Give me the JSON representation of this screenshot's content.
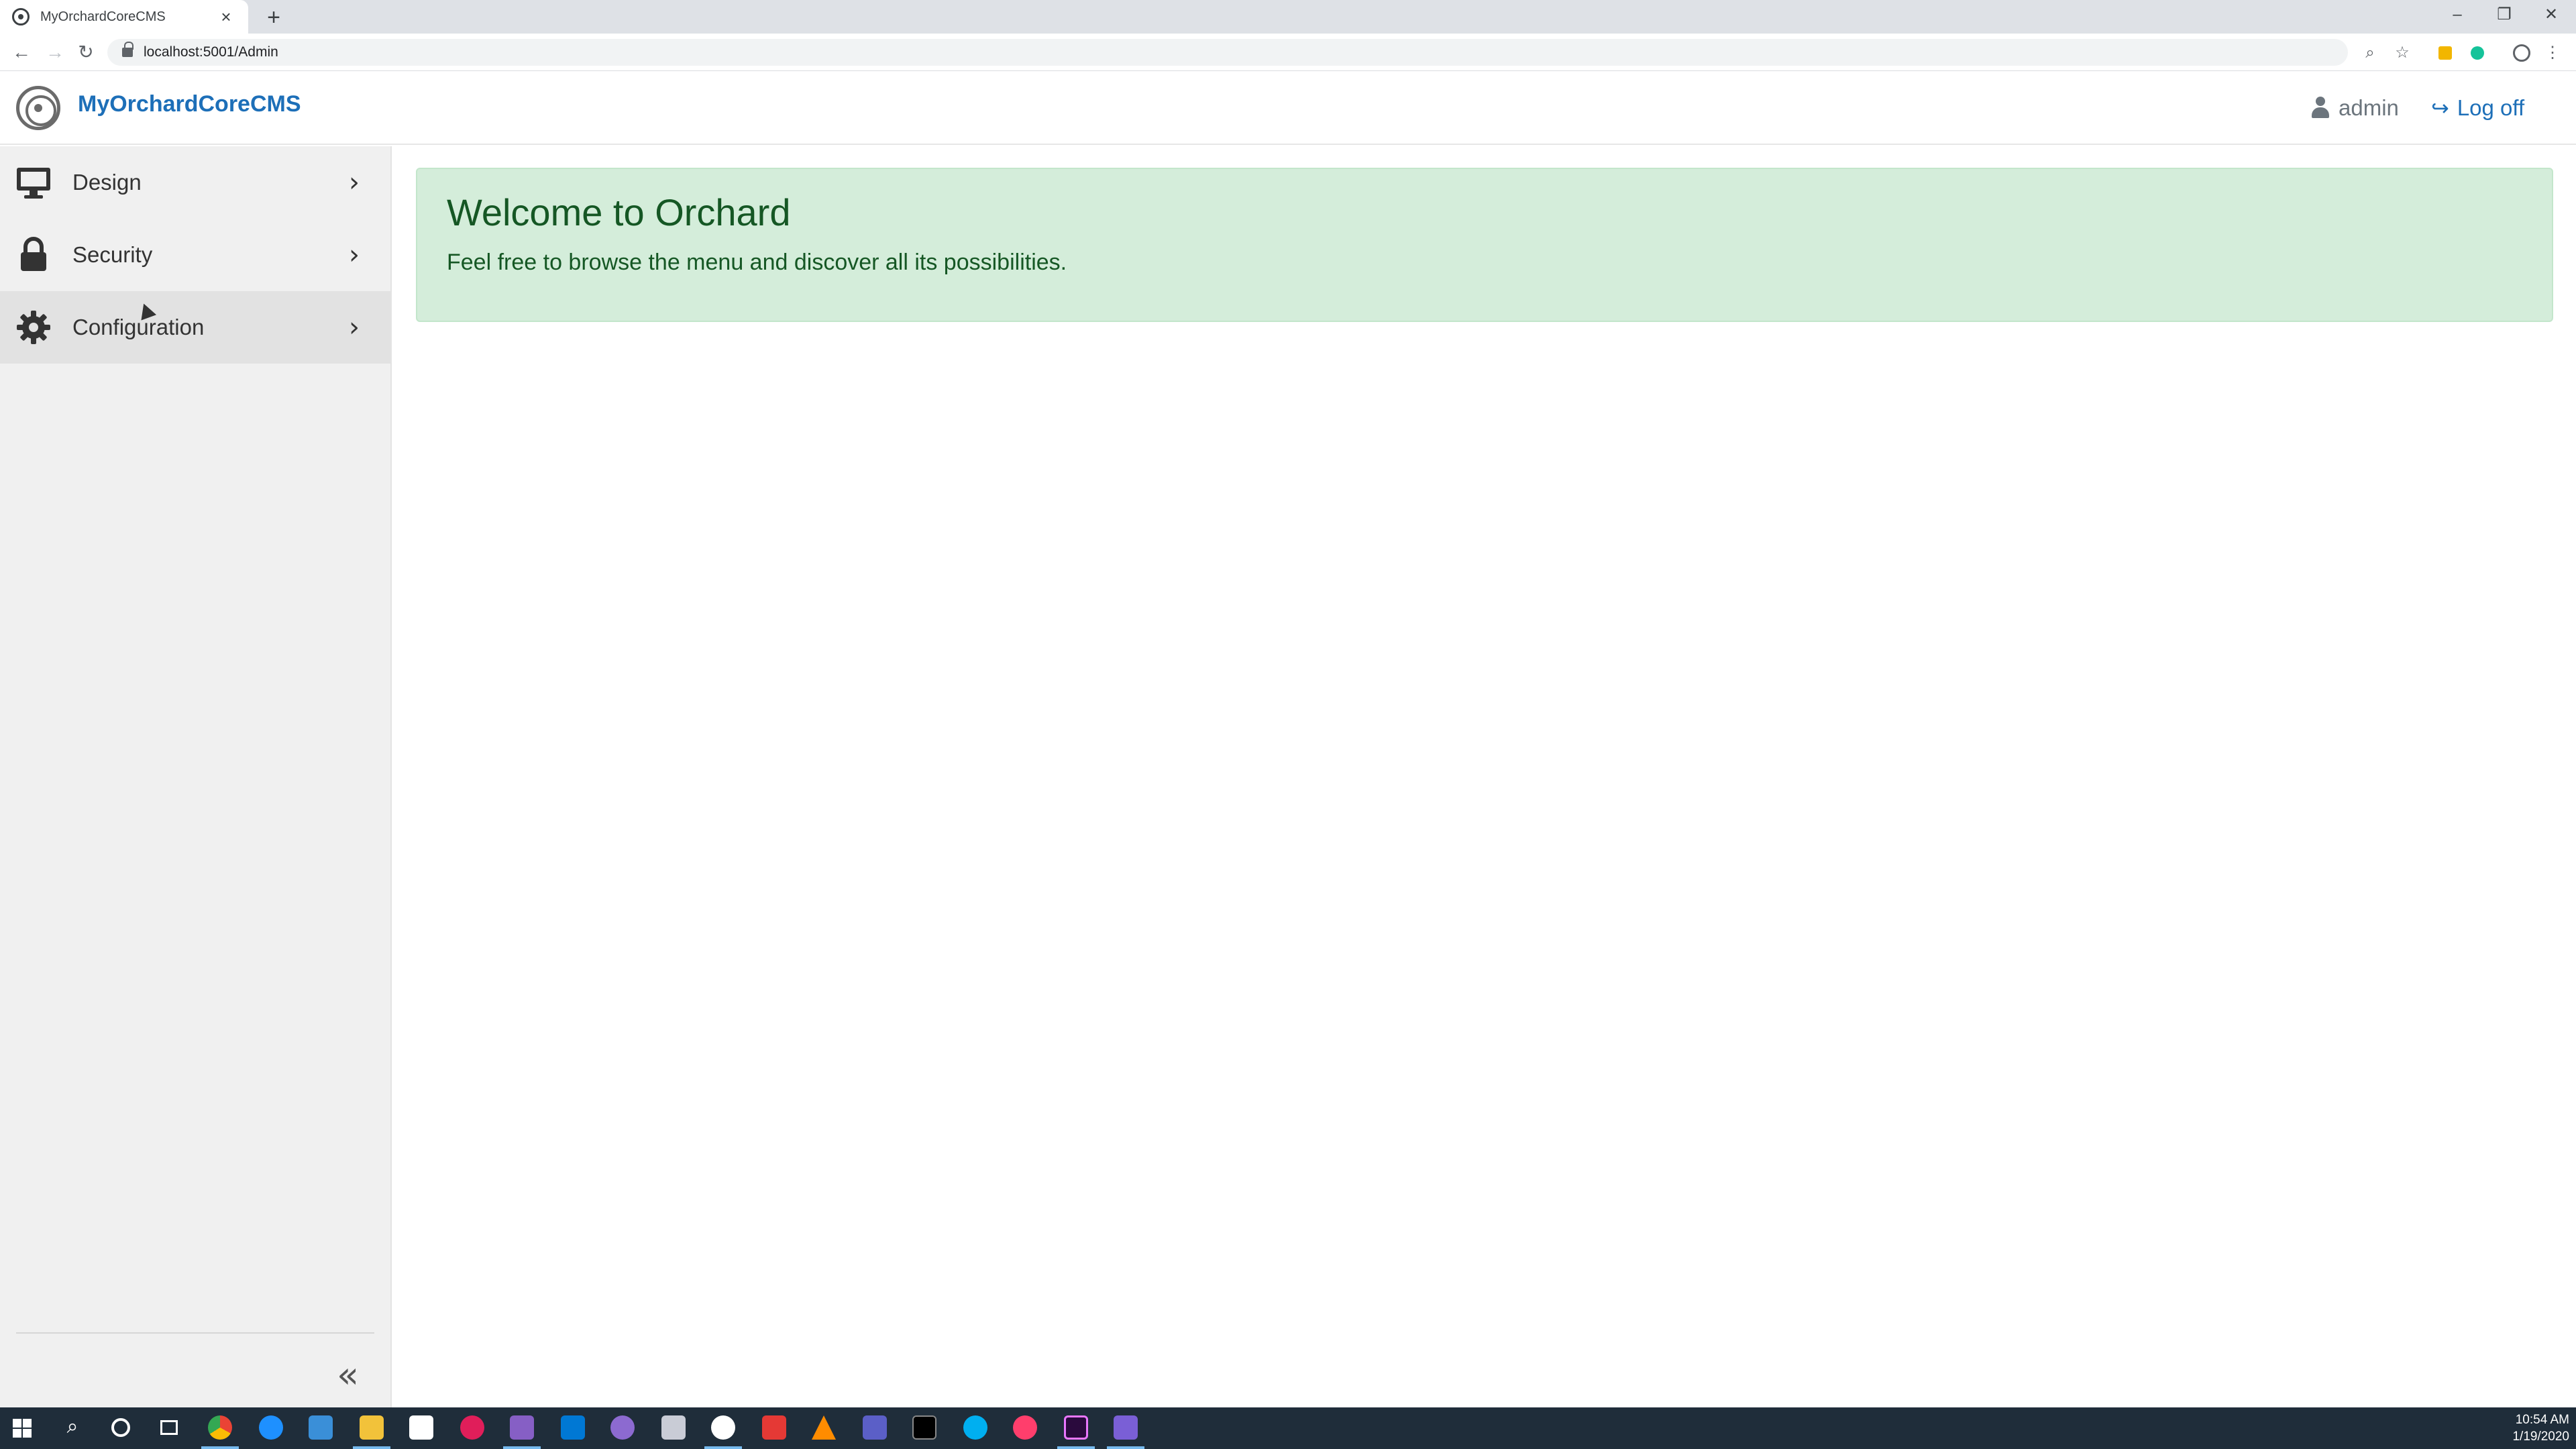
{
  "browser": {
    "tab_title": "MyOrchardCoreCMS",
    "tab_close": "×",
    "new_tab": "+",
    "url": "localhost:5001/Admin",
    "minimize": "–",
    "maximize": "❐",
    "close": "✕",
    "back": "←",
    "forward": "→",
    "reload": "↻",
    "zoom_icon": "⌕",
    "star_icon": "☆",
    "menu_icon": "⋮"
  },
  "header": {
    "brand": "MyOrchardCoreCMS",
    "user": "admin",
    "logoff": "Log off"
  },
  "sidebar": {
    "items": [
      {
        "label": "Design",
        "icon": "monitor-icon"
      },
      {
        "label": "Security",
        "icon": "lock-icon"
      },
      {
        "label": "Configuration",
        "icon": "gear-icon"
      }
    ],
    "chevron": "›",
    "collapse": "«"
  },
  "main": {
    "welcome_title": "Welcome to Orchard",
    "welcome_text": "Feel free to browse the menu and discover all its possibilities."
  },
  "taskbar": {
    "time": "10:54 AM",
    "date": "1/19/2020"
  },
  "colors": {
    "brand": "#1d6fb8",
    "alert_bg": "#d4edda",
    "alert_text": "#155724",
    "sidebar_bg": "#f0f0f0",
    "taskbar_bg": "#1f2d3a"
  }
}
